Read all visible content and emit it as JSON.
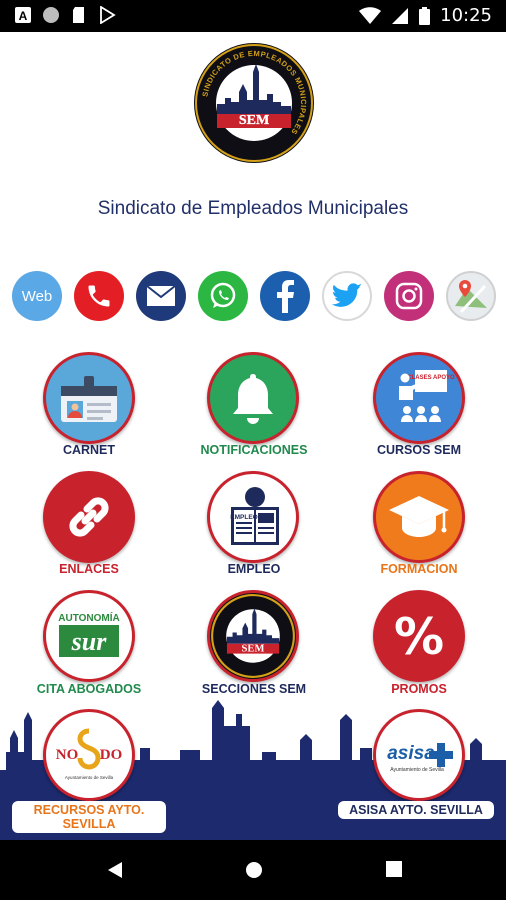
{
  "status_bar": {
    "time": "10:25",
    "left_icons": [
      "a-square-icon",
      "circle-icon",
      "sd-card-icon",
      "play-store-icon"
    ],
    "right_icons": [
      "wifi-icon",
      "cell-signal-icon",
      "battery-icon"
    ]
  },
  "header": {
    "logo_text": "SEM",
    "logo_ring_text": "SINDICATO DE EMPLEADOS MUNICIPALES",
    "tagline": "Sindicato de Empleados Municipales"
  },
  "social": {
    "web_label": "Web",
    "items": [
      "web",
      "phone",
      "email",
      "whatsapp",
      "facebook",
      "twitter",
      "instagram",
      "maps"
    ]
  },
  "tiles": [
    {
      "label": "CARNET",
      "color": "#1f2a5c"
    },
    {
      "label": "NOTIFICACIONES",
      "color": "#1f8a4c"
    },
    {
      "label": "CURSOS SEM",
      "color": "#1f2a5c"
    },
    {
      "label": "ENLACES",
      "color": "#c8222d"
    },
    {
      "label": "EMPLEO",
      "color": "#1f2a5c"
    },
    {
      "label": "FORMACION",
      "color": "#e8751a"
    },
    {
      "label": "CITA ABOGADOS",
      "color": "#1f8a4c"
    },
    {
      "label": "SECCIONES SEM",
      "color": "#1f2a5c"
    },
    {
      "label": "PROMOS",
      "color": "#c8222d"
    }
  ],
  "tile_texts": {
    "clases_apoyo": "CLASES APOYO",
    "empleo_sign": "EMPLEO",
    "autonomia": "AUTONOMÍA",
    "sur": "sur",
    "nodo_left": "NO",
    "nodo_right": "DO",
    "nodo_sub": "Ayuntamiento de Sevilla",
    "asisa": "asisa",
    "asisa_sub": "Ayuntamiento de Sevilla",
    "percent": "%"
  },
  "bottom": {
    "recursos_label_1": "RECURSOS AYTO.",
    "recursos_label_2": "SEVILLA",
    "asisa_label": "ASISA AYTO. SEVILLA"
  },
  "colors": {
    "navy": "#1f2a5c",
    "red": "#c8222d",
    "green": "#1f8a4c",
    "orange": "#e8751a",
    "skyline": "#1d2a6e"
  }
}
